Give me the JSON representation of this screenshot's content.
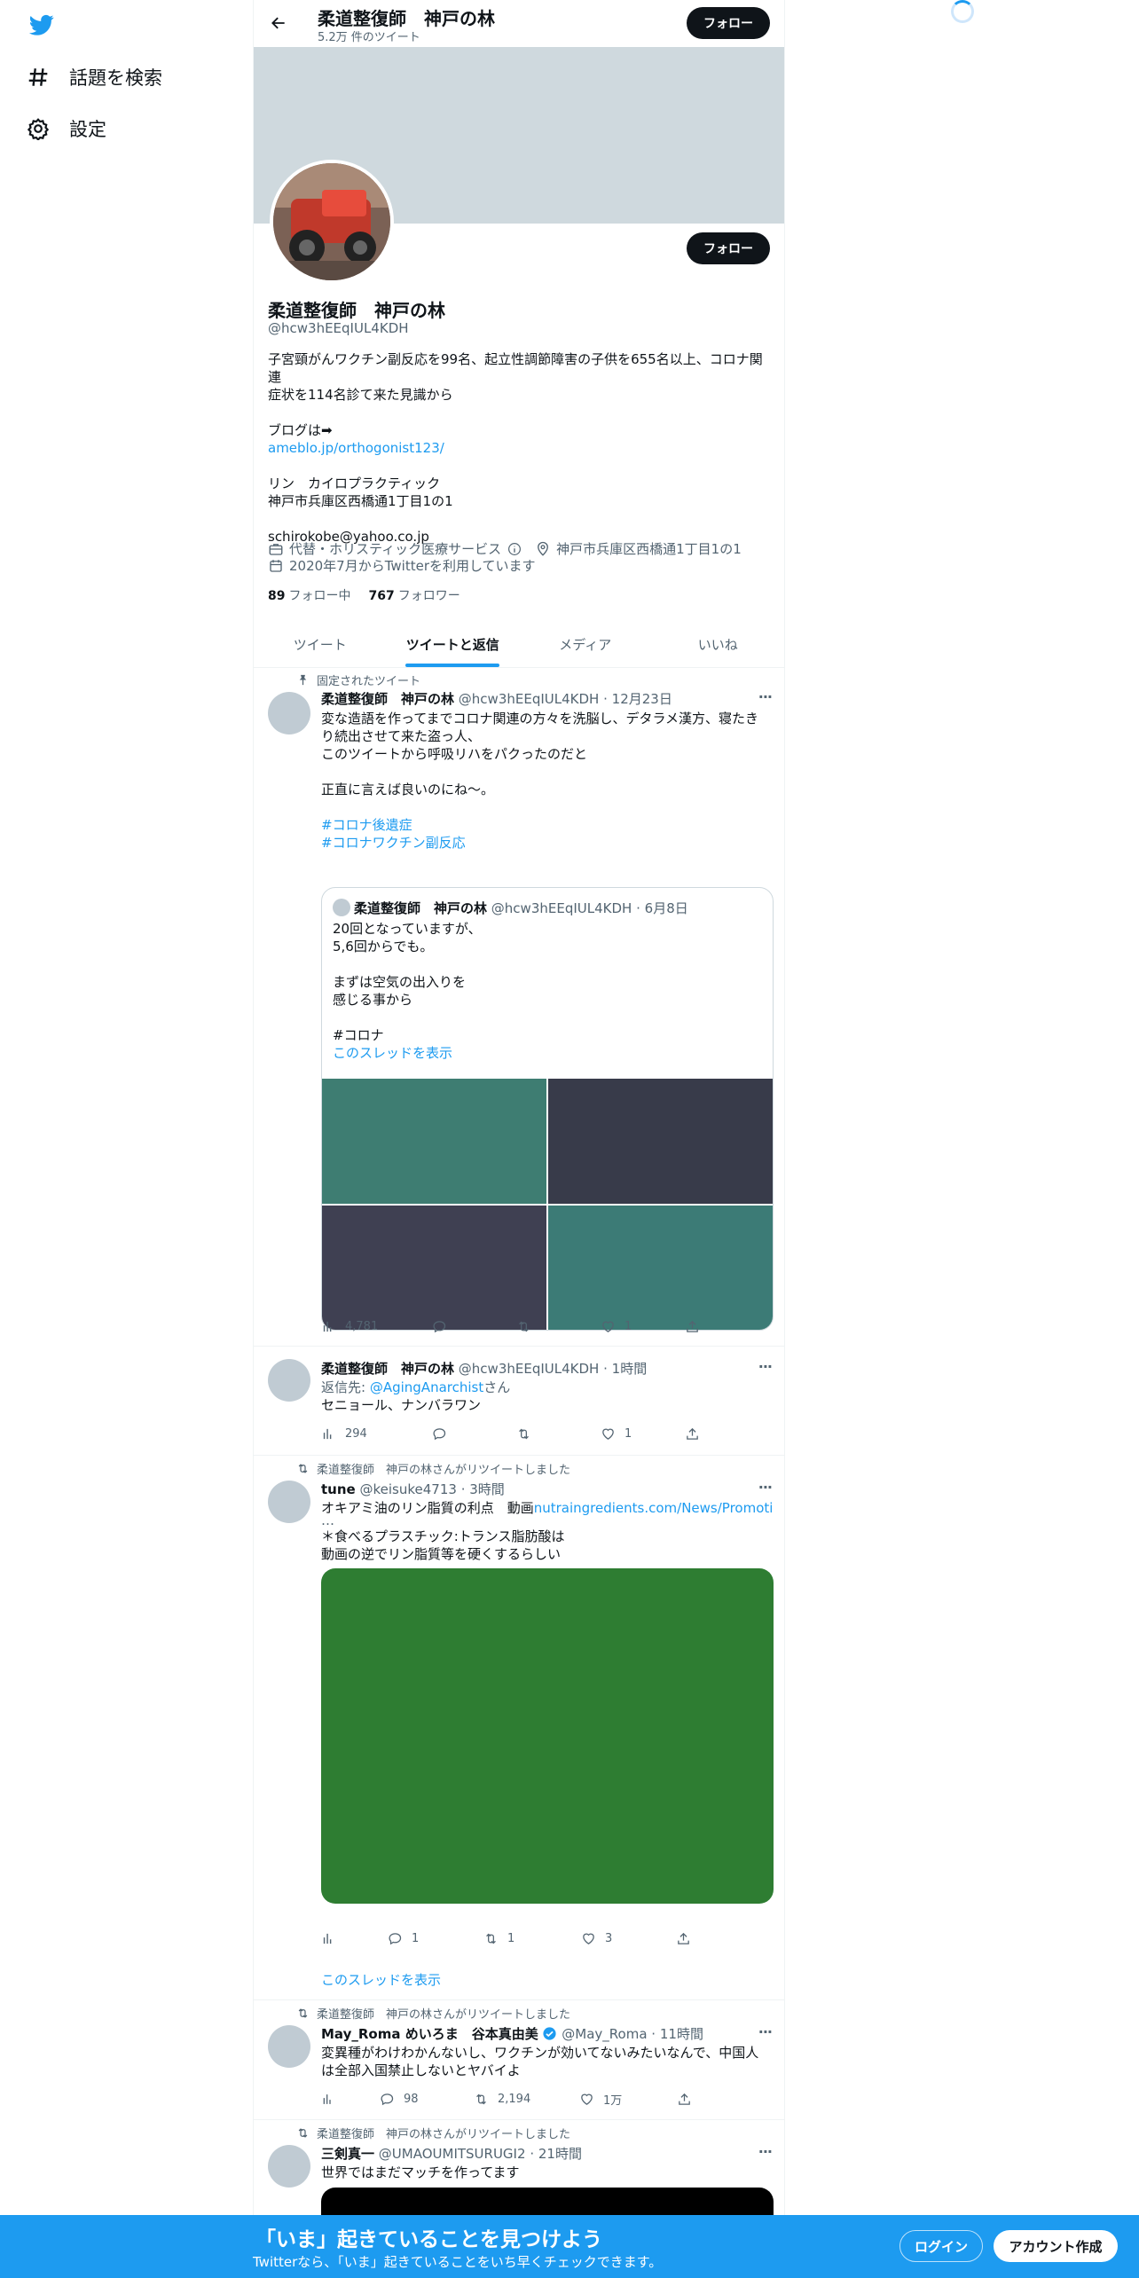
{
  "nav": {
    "explore_label": "話題を検索",
    "settings_label": "設定"
  },
  "topbar": {
    "name": "柔道整復師　神戸の林",
    "tweet_count": "5.2万 件のツイート",
    "follow_label": "フォロー"
  },
  "profile": {
    "follow_label": "フォロー",
    "name": "柔道整復師　神戸の林",
    "handle": "@hcw3hEEqIUL4KDH",
    "bio": [
      "子宮頸がんワクチン副反応を99名、起立性調節障害の子供を655名以上、コロナ関連",
      "症状を114名診て来た見識から",
      "",
      "ブログは➡",
      "ameblo.jp/orthogonist123/",
      "",
      "リン　カイロプラクティック",
      "神戸市兵庫区西橋通1丁目1の1",
      "",
      "schirokobe@yahoo.co.jp"
    ],
    "category": "代替・ホリスティック医療サービス",
    "location": "神戸市兵庫区西橋通1丁目1の1",
    "joined": "2020年7月からTwitterを利用しています",
    "following_count": "89",
    "following_label": "フォロー中",
    "followers_count": "767",
    "followers_label": "フォロワー"
  },
  "tabs": [
    {
      "label": "ツイート"
    },
    {
      "label": "ツイートと返信"
    },
    {
      "label": "メディア"
    },
    {
      "label": "いいね"
    }
  ],
  "tweets": [
    {
      "context": "固定されたツイート",
      "name": "柔道整復師　神戸の林",
      "handle": "@hcw3hEEqIUL4KDH",
      "time": "12月23日",
      "lines": [
        "変な造語を作ってまでコロナ関連の方々を洗脳し、デタラメ漢方、寝たき",
        "り続出させて来た盗っ人、",
        "このツイートから呼吸リハをパクったのだと",
        "",
        "正直に言えば良いのにね〜。",
        "",
        "#コロナ後遺症",
        "#コロナワクチン副反応"
      ],
      "quote": {
        "name": "柔道整復師　神戸の林",
        "handle": "@hcw3hEEqIUL4KDH",
        "time": "6月8日",
        "lines": [
          "20回となっていますが、",
          "5,6回からでも。",
          "",
          "まずは空気の出入りを",
          "感じる事から",
          "",
          "#コロナ"
        ],
        "thread_link": "このスレッドを表示",
        "image_colors": [
          "#3e7d72",
          "#383b4a",
          "#3f4052",
          "#3c7b76"
        ]
      },
      "views": "4,781",
      "replies": "",
      "retweets": "",
      "likes": "1"
    },
    {
      "name": "柔道整復師　神戸の林",
      "handle": "@hcw3hEEqIUL4KDH",
      "time": "1時間",
      "reply_prefix": "返信先: ",
      "reply_to": "@AgingAnarchist",
      "reply_suffix": "さん",
      "text": "セニョール、ナンバラワン",
      "views": "294",
      "replies": "",
      "retweets": "",
      "likes": "1"
    },
    {
      "context": "柔道整復師　神戸の林さんがリツイートしました",
      "name": "tune",
      "handle": "@keisuke4713",
      "time": "3時間",
      "line1": "オキアミ油のリン脂質の利点　動画",
      "link": "nutraingredients.com/News/Promotion",
      "lines": [
        "＊食べるプラスチック:トランス脂肪酸は",
        "動画の逆でリン脂質等を硬くするらしい"
      ],
      "views": "",
      "replies": "1",
      "retweets": "1",
      "likes": "3",
      "thread_link": "このスレッドを表示",
      "media_color": "#2e7d32"
    },
    {
      "context": "柔道整復師　神戸の林さんがリツイートしました",
      "name": "May_Roma めいろま　谷本真由美",
      "handle": "@May_Roma",
      "time": "11時間",
      "lines": [
        "変異種がわけわかんないし、ワクチンが効いてないみたいなんで、中国人",
        "は全部入国禁止しないとヤバイよ"
      ],
      "views": "",
      "replies": "98",
      "retweets": "2,194",
      "likes": "1万"
    },
    {
      "context": "柔道整復師　神戸の林さんがリツイートしました",
      "name": "三剣真一",
      "handle": "@UMAOUMITSURUGI2",
      "time": "21時間",
      "text": "世界ではまだマッチを作ってます"
    }
  ],
  "bottombar": {
    "title": "「いま」起きていることを見つけよう",
    "subtitle": "Twitterなら、「いま」起きていることをいち早くチェックできます。",
    "login_label": "ログイン",
    "signup_label": "アカウント作成"
  }
}
